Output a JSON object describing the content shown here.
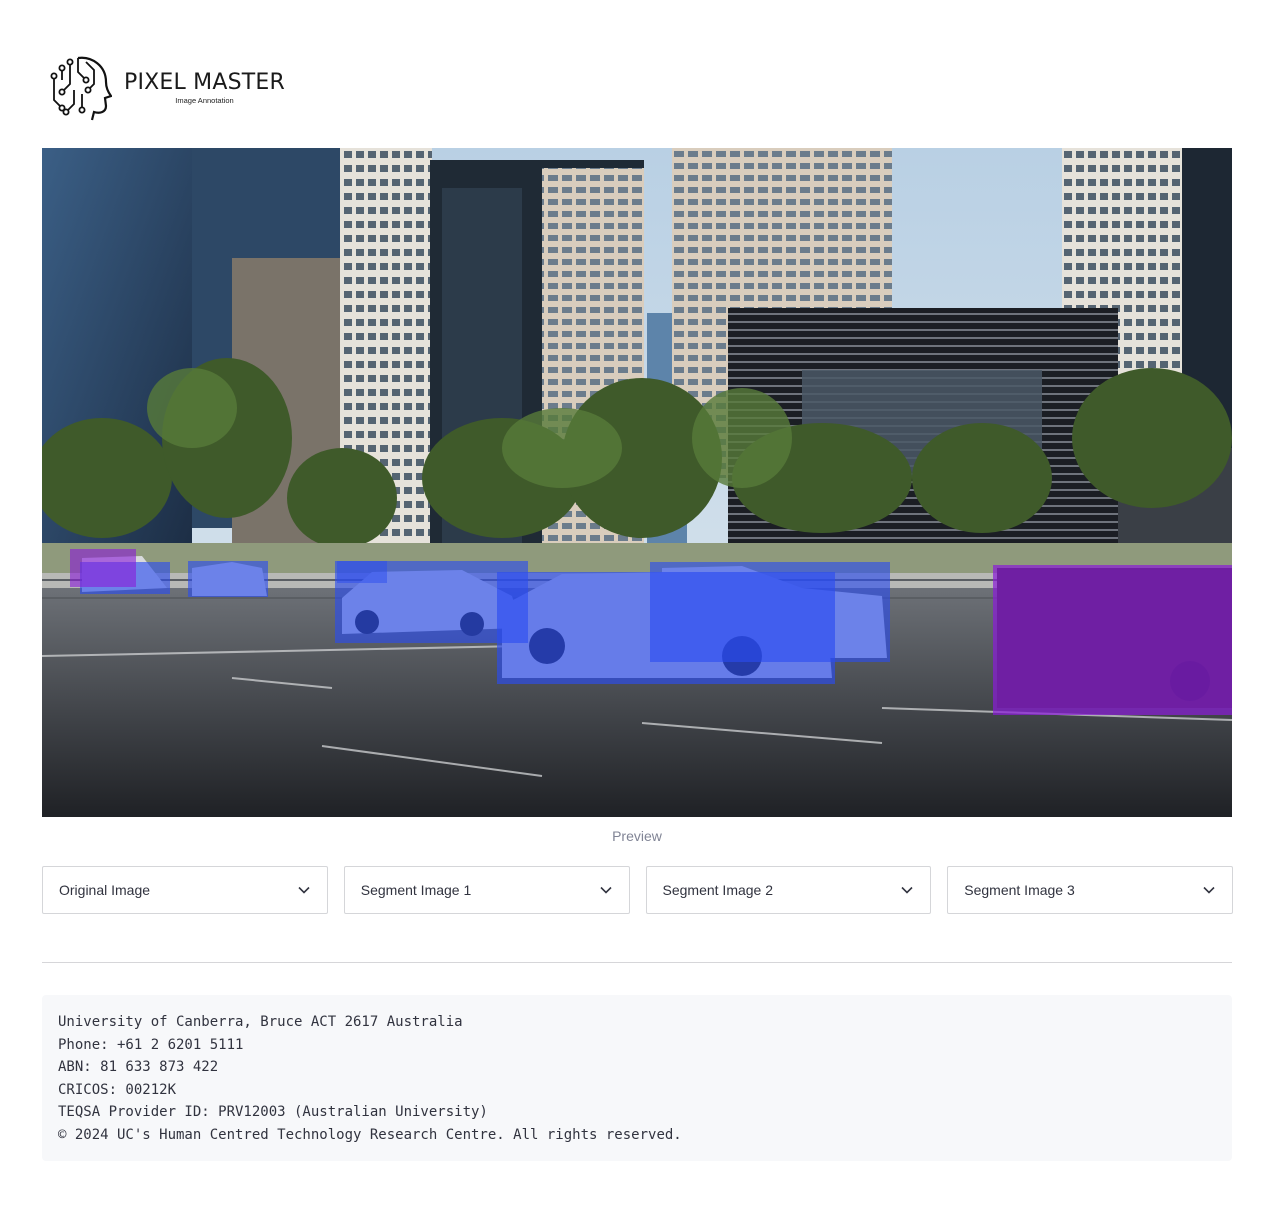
{
  "app": {
    "brand_name": "PIXEL MASTER",
    "brand_tagline": "Image Annotation",
    "logo_icon": "ai-head-circuit-icon"
  },
  "preview": {
    "caption": "Preview",
    "annotation_colors": {
      "car": "#2a4cf0",
      "vehicle-other": "#8a1bd8"
    },
    "annotation_classes": [
      "car",
      "car",
      "car",
      "car",
      "car",
      "car",
      "vehicle-other",
      "vehicle-other"
    ]
  },
  "selects": [
    {
      "value": "Original Image",
      "icon": "chevron-down-icon"
    },
    {
      "value": "Segment Image 1",
      "icon": "chevron-down-icon"
    },
    {
      "value": "Segment Image 2",
      "icon": "chevron-down-icon"
    },
    {
      "value": "Segment Image 3",
      "icon": "chevron-down-icon"
    }
  ],
  "footer": {
    "address": "University of Canberra, Bruce ACT 2617 Australia",
    "phone": "Phone: +61 2 6201 5111",
    "abn": "ABN: 81 633 873 422",
    "cricos": "CRICOS: 00212K",
    "teqsa": "TEQSA Provider ID: PRV12003 (Australian University)",
    "copyright": "© 2024 UC's Human Centred Technology Research Centre. All rights reserved."
  }
}
